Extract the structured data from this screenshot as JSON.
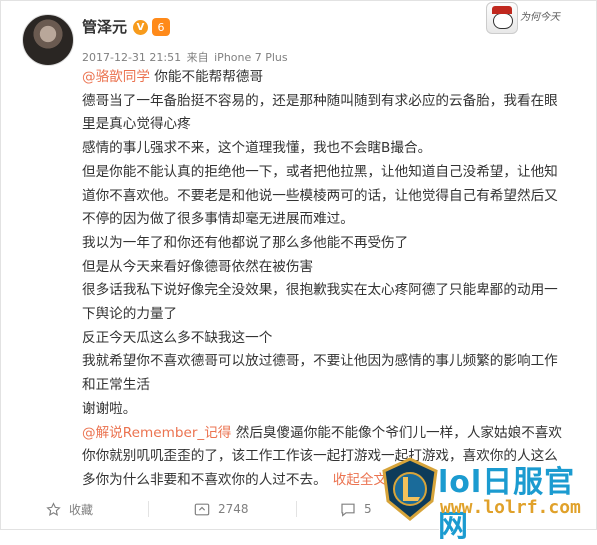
{
  "post": {
    "username": "管泽元",
    "verified_badge": "V",
    "level_badge": "6",
    "timestamp": "2017-12-31 21:51",
    "source_prefix": "来自",
    "source": "iPhone 7 Plus",
    "lines": [
      {
        "mention": "@骆歆同学",
        "text": " 你能不能帮帮德哥"
      },
      {
        "text": "德哥当了一年备胎挺不容易的，还是那种随叫随到有求必应的云备胎，我看在眼"
      },
      {
        "text": "里是真心觉得心疼"
      },
      {
        "text": "感情的事儿强求不来，这个道理我懂，我也不会瞎B撮合。"
      },
      {
        "text": "但是你能不能认真的拒绝他一下，或者把他拉黑，让他知道自己没希望，让他知"
      },
      {
        "text": "道你不喜欢他。不要老是和他说一些模棱两可的话，让他觉得自己有希望然后又"
      },
      {
        "text": "不停的因为做了很多事情却毫无进展而难过。"
      },
      {
        "text": "我以为一年了和你还有他都说了那么多他能不再受伤了"
      },
      {
        "text": "但是从今天来看好像德哥依然在被伤害"
      },
      {
        "text": "很多话我私下说好像完全没效果，很抱歉我实在太心疼阿德了只能卑鄙的动用一"
      },
      {
        "text": "下舆论的力量了"
      },
      {
        "text": "反正今天瓜这么多不缺我这一个"
      },
      {
        "text": "我就希望你不喜欢德哥可以放过德哥，不要让他因为感情的事儿频繁的影响工作"
      },
      {
        "text": "和正常生活"
      },
      {
        "text": "谢谢啦。"
      },
      {
        "mention": "@解说Remember_记得",
        "text": " 然后臭傻逼你能不能像个爷们儿一样，人家姑娘不喜欢"
      },
      {
        "text": "你你就别叽叽歪歪的了，该工作工作该一起打游戏一起打游戏，喜欢你的人这么"
      },
      {
        "text": "多你为什么非要和不喜欢你的人过不去。",
        "collapse": "收起全文"
      }
    ]
  },
  "toolbar": {
    "favorite_label": "收藏",
    "repost_count": "2748",
    "comment_count": "5"
  },
  "header_logo": {
    "script_text": "为何今天"
  },
  "watermark": {
    "brand": "lol日服官网",
    "url": "www.lolrf.com"
  },
  "colors": {
    "link": "#eb7350",
    "brand_blue": "#1b9bd0",
    "brand_gold": "#e0a12a",
    "verified": "#f79b1c"
  }
}
